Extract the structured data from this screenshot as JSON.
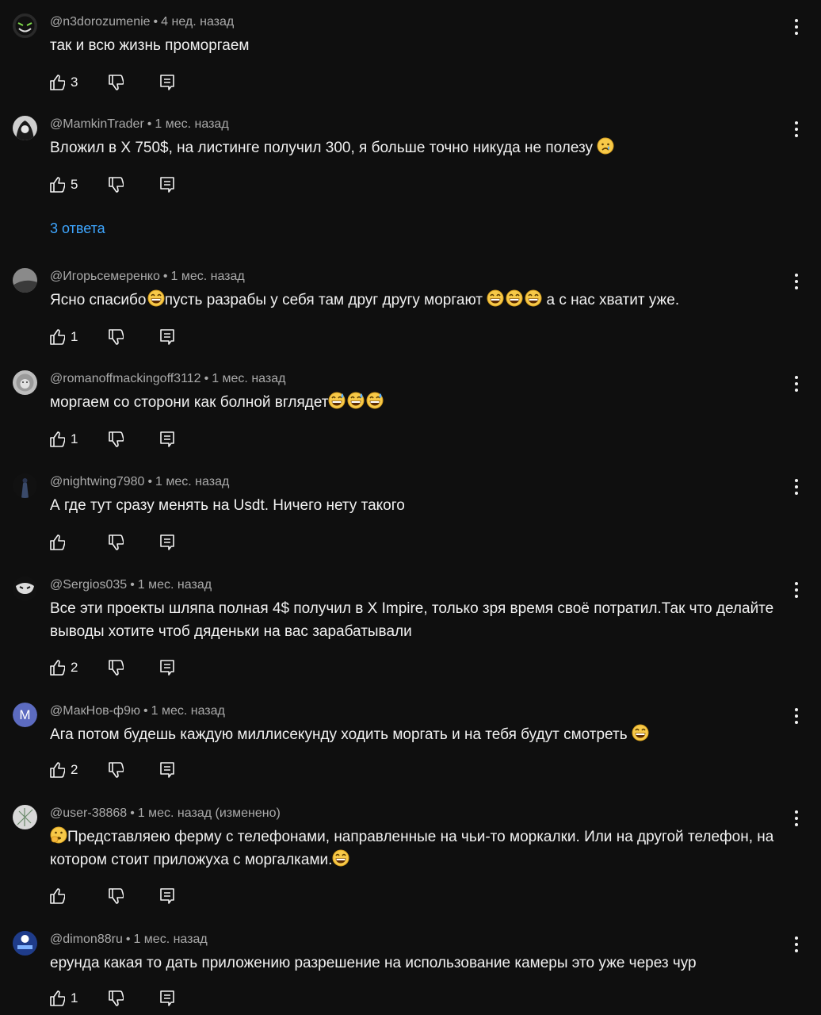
{
  "comments": [
    {
      "author": "@n3dorozumenie",
      "time": "4 нед. назад",
      "text_parts": [
        "так и всю жизнь проморгаем"
      ],
      "likes": "3",
      "avatar_icon": "masked-face-avatar"
    },
    {
      "author": "@MamkinTrader",
      "time": "1 мес. назад",
      "text_parts": [
        "Вложил в X 750$, на листинге получил 300, я больше точно никуда не полезу "
      ],
      "likes": "5",
      "avatar_icon": "hooded-figure-avatar",
      "emoji_after": [
        "crying-face-emoji"
      ]
    },
    {
      "author": "@Игорьсемеренко",
      "time": "1 мес. назад",
      "text_parts": [
        "Ясно спасибо ",
        "пусть разрабы у себя там друг другу моргают ",
        " а с нас хватит уже."
      ],
      "likes": "1",
      "avatar_icon": "gray-photo-avatar"
    },
    {
      "author": "@romanoffmackingoff3112",
      "time": "1 мес. назад",
      "text_parts": [
        "моргаем со сторони как болной вглядет"
      ],
      "likes": "1",
      "avatar_icon": "lion-avatar"
    },
    {
      "author": "@nightwing7980",
      "time": "1 мес. назад",
      "text_parts": [
        "А где тут сразу менять на Usdt. Ничего нету такого"
      ],
      "likes": "",
      "avatar_icon": "dark-figure-avatar"
    },
    {
      "author": "@Sergios035",
      "time": "1 мес. назад",
      "text_parts": [
        "Все эти проекты шляпа полная 4$ получил в X Impire, только зря время своё потратил.Так что делайте выводы хотите чтоб дяденьки на вас зарабатывали"
      ],
      "likes": "2",
      "avatar_icon": "mask-logo-avatar"
    },
    {
      "author": "@МакНов-ф9ю",
      "time": "1 мес. назад",
      "text_parts": [
        "Ага потом будешь каждую миллисекунду ходить моргать и на тебя будут смотреть "
      ],
      "likes": "2",
      "avatar_letter": "М"
    },
    {
      "author": "@user-38868",
      "time": "1 мес. назад (изменено)",
      "text_parts": [
        "Представляею ферму с телефонами, направленные на чьи-то моркалки. Или на другой телефон, на котором стоит приложуха с моргалками."
      ],
      "likes": "",
      "avatar_icon": "sketch-avatar"
    },
    {
      "author": "@dimon88ru",
      "time": "1 мес. назад",
      "text_parts": [
        "ерунда какая то дать приложению разрешение на использование камеры это уже через чур"
      ],
      "likes": "1",
      "avatar_icon": "blue-logo-avatar"
    }
  ],
  "replies_link": "3 ответа",
  "sep": "•",
  "colors": {
    "background": "#0f0f0f",
    "text": "#f1f1f1",
    "meta": "#aaaaaa",
    "link": "#3ea6ff"
  }
}
